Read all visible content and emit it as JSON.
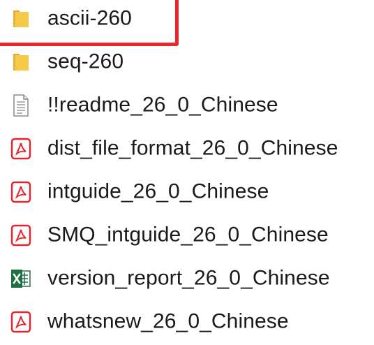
{
  "files": [
    {
      "name": "ascii-260",
      "icon": "folder-icon",
      "type": "folder"
    },
    {
      "name": "seq-260",
      "icon": "folder-icon",
      "type": "folder"
    },
    {
      "name": "!!readme_26_0_Chinese",
      "icon": "text-file-icon",
      "type": "text"
    },
    {
      "name": "dist_file_format_26_0_Chinese",
      "icon": "pdf-icon",
      "type": "pdf"
    },
    {
      "name": "intguide_26_0_Chinese",
      "icon": "pdf-icon",
      "type": "pdf"
    },
    {
      "name": "SMQ_intguide_26_0_Chinese",
      "icon": "pdf-icon",
      "type": "pdf"
    },
    {
      "name": "version_report_26_0_Chinese",
      "icon": "excel-icon",
      "type": "excel"
    },
    {
      "name": "whatsnew_26_0_Chinese",
      "icon": "pdf-icon",
      "type": "pdf"
    }
  ],
  "highlight": {
    "color": "#e8262b",
    "target": "ascii-260"
  },
  "colors": {
    "folder": "#f5c33b",
    "pdf": "#e3262d",
    "excel": "#1e7145",
    "text": "#8a8a8a"
  }
}
